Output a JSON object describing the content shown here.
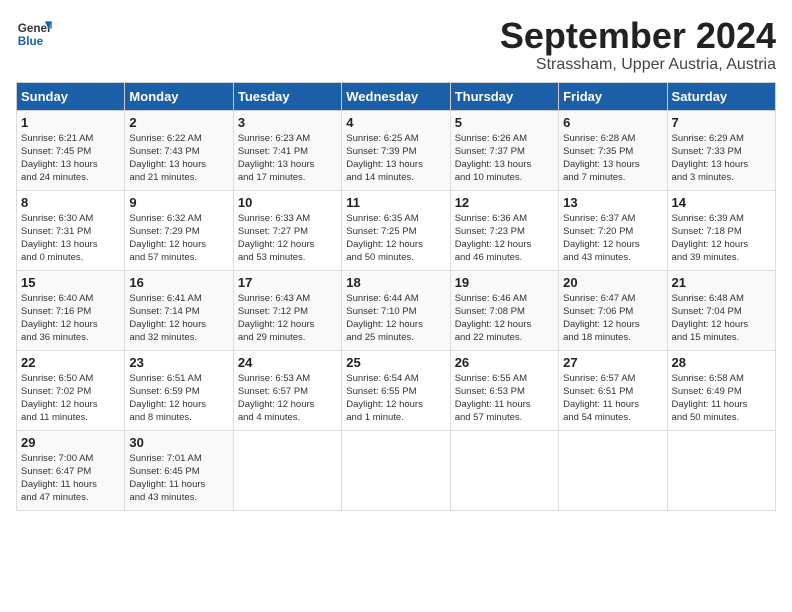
{
  "logo": {
    "line1": "General",
    "line2": "Blue"
  },
  "title": "September 2024",
  "location": "Strassham, Upper Austria, Austria",
  "days_of_week": [
    "Sunday",
    "Monday",
    "Tuesday",
    "Wednesday",
    "Thursday",
    "Friday",
    "Saturday"
  ],
  "weeks": [
    [
      {
        "day": "1",
        "info": "Sunrise: 6:21 AM\nSunset: 7:45 PM\nDaylight: 13 hours\nand 24 minutes."
      },
      {
        "day": "2",
        "info": "Sunrise: 6:22 AM\nSunset: 7:43 PM\nDaylight: 13 hours\nand 21 minutes."
      },
      {
        "day": "3",
        "info": "Sunrise: 6:23 AM\nSunset: 7:41 PM\nDaylight: 13 hours\nand 17 minutes."
      },
      {
        "day": "4",
        "info": "Sunrise: 6:25 AM\nSunset: 7:39 PM\nDaylight: 13 hours\nand 14 minutes."
      },
      {
        "day": "5",
        "info": "Sunrise: 6:26 AM\nSunset: 7:37 PM\nDaylight: 13 hours\nand 10 minutes."
      },
      {
        "day": "6",
        "info": "Sunrise: 6:28 AM\nSunset: 7:35 PM\nDaylight: 13 hours\nand 7 minutes."
      },
      {
        "day": "7",
        "info": "Sunrise: 6:29 AM\nSunset: 7:33 PM\nDaylight: 13 hours\nand 3 minutes."
      }
    ],
    [
      {
        "day": "8",
        "info": "Sunrise: 6:30 AM\nSunset: 7:31 PM\nDaylight: 13 hours\nand 0 minutes."
      },
      {
        "day": "9",
        "info": "Sunrise: 6:32 AM\nSunset: 7:29 PM\nDaylight: 12 hours\nand 57 minutes."
      },
      {
        "day": "10",
        "info": "Sunrise: 6:33 AM\nSunset: 7:27 PM\nDaylight: 12 hours\nand 53 minutes."
      },
      {
        "day": "11",
        "info": "Sunrise: 6:35 AM\nSunset: 7:25 PM\nDaylight: 12 hours\nand 50 minutes."
      },
      {
        "day": "12",
        "info": "Sunrise: 6:36 AM\nSunset: 7:23 PM\nDaylight: 12 hours\nand 46 minutes."
      },
      {
        "day": "13",
        "info": "Sunrise: 6:37 AM\nSunset: 7:20 PM\nDaylight: 12 hours\nand 43 minutes."
      },
      {
        "day": "14",
        "info": "Sunrise: 6:39 AM\nSunset: 7:18 PM\nDaylight: 12 hours\nand 39 minutes."
      }
    ],
    [
      {
        "day": "15",
        "info": "Sunrise: 6:40 AM\nSunset: 7:16 PM\nDaylight: 12 hours\nand 36 minutes."
      },
      {
        "day": "16",
        "info": "Sunrise: 6:41 AM\nSunset: 7:14 PM\nDaylight: 12 hours\nand 32 minutes."
      },
      {
        "day": "17",
        "info": "Sunrise: 6:43 AM\nSunset: 7:12 PM\nDaylight: 12 hours\nand 29 minutes."
      },
      {
        "day": "18",
        "info": "Sunrise: 6:44 AM\nSunset: 7:10 PM\nDaylight: 12 hours\nand 25 minutes."
      },
      {
        "day": "19",
        "info": "Sunrise: 6:46 AM\nSunset: 7:08 PM\nDaylight: 12 hours\nand 22 minutes."
      },
      {
        "day": "20",
        "info": "Sunrise: 6:47 AM\nSunset: 7:06 PM\nDaylight: 12 hours\nand 18 minutes."
      },
      {
        "day": "21",
        "info": "Sunrise: 6:48 AM\nSunset: 7:04 PM\nDaylight: 12 hours\nand 15 minutes."
      }
    ],
    [
      {
        "day": "22",
        "info": "Sunrise: 6:50 AM\nSunset: 7:02 PM\nDaylight: 12 hours\nand 11 minutes."
      },
      {
        "day": "23",
        "info": "Sunrise: 6:51 AM\nSunset: 6:59 PM\nDaylight: 12 hours\nand 8 minutes."
      },
      {
        "day": "24",
        "info": "Sunrise: 6:53 AM\nSunset: 6:57 PM\nDaylight: 12 hours\nand 4 minutes."
      },
      {
        "day": "25",
        "info": "Sunrise: 6:54 AM\nSunset: 6:55 PM\nDaylight: 12 hours\nand 1 minute."
      },
      {
        "day": "26",
        "info": "Sunrise: 6:55 AM\nSunset: 6:53 PM\nDaylight: 11 hours\nand 57 minutes."
      },
      {
        "day": "27",
        "info": "Sunrise: 6:57 AM\nSunset: 6:51 PM\nDaylight: 11 hours\nand 54 minutes."
      },
      {
        "day": "28",
        "info": "Sunrise: 6:58 AM\nSunset: 6:49 PM\nDaylight: 11 hours\nand 50 minutes."
      }
    ],
    [
      {
        "day": "29",
        "info": "Sunrise: 7:00 AM\nSunset: 6:47 PM\nDaylight: 11 hours\nand 47 minutes."
      },
      {
        "day": "30",
        "info": "Sunrise: 7:01 AM\nSunset: 6:45 PM\nDaylight: 11 hours\nand 43 minutes."
      },
      {
        "day": "",
        "info": ""
      },
      {
        "day": "",
        "info": ""
      },
      {
        "day": "",
        "info": ""
      },
      {
        "day": "",
        "info": ""
      },
      {
        "day": "",
        "info": ""
      }
    ]
  ]
}
